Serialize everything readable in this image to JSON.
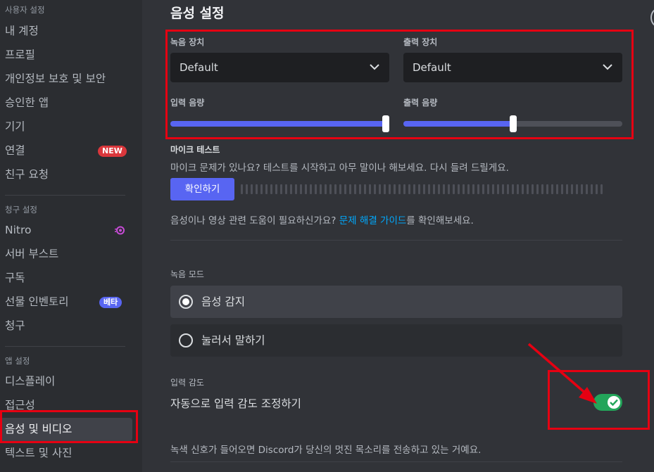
{
  "sidebar": {
    "sections": [
      {
        "header": "사용자 설정",
        "items": [
          {
            "label": "내 계정"
          },
          {
            "label": "프로필"
          },
          {
            "label": "개인정보 보호 및 보안"
          },
          {
            "label": "승인한 앱"
          },
          {
            "label": "기기"
          },
          {
            "label": "연결",
            "badge": "NEW"
          },
          {
            "label": "친구 요청"
          }
        ]
      },
      {
        "header": "청구 설정",
        "items": [
          {
            "label": "Nitro"
          },
          {
            "label": "서버 부스트"
          },
          {
            "label": "구독"
          },
          {
            "label": "선물 인벤토리",
            "badge": "베타"
          },
          {
            "label": "청구"
          }
        ]
      },
      {
        "header": "앱 설정",
        "items": [
          {
            "label": "디스플레이"
          },
          {
            "label": "접근성"
          },
          {
            "label": "음성 및 비디오",
            "active": true
          },
          {
            "label": "텍스트 및 사진"
          }
        ]
      }
    ]
  },
  "main": {
    "title": "음성 설정",
    "input_device": {
      "label": "녹음 장치",
      "value": "Default"
    },
    "output_device": {
      "label": "출력 장치",
      "value": "Default"
    },
    "input_volume": {
      "label": "입력 음량",
      "level": 1.0
    },
    "output_volume": {
      "label": "출력 음량",
      "level": 0.5
    },
    "mic_test": {
      "label": "마이크 테스트",
      "description": "마이크 문제가 있나요? 테스트를 시작하고 아무 말이나 해보세요. 다시 들려 드릴게요.",
      "button": "확인하기"
    },
    "help": {
      "prefix": "음성이나 영상 관련 도움이 필요하신가요? ",
      "link": "문제 해결 가이드",
      "suffix": "를 확인해보세요."
    },
    "input_mode": {
      "label": "녹음 모드",
      "options": [
        {
          "label": "음성 감지",
          "selected": true
        },
        {
          "label": "눌러서 말하기",
          "selected": false
        }
      ]
    },
    "sensitivity": {
      "label": "입력 감도",
      "auto_label": "자동으로 입력 감도 조정하기",
      "auto_enabled": true,
      "note": "녹색 신호가 들어오면 Discord가 당신의 멋진 목소리를 전송하고 있는 거예요."
    }
  },
  "colors": {
    "accent": "#5865f2",
    "toggle_on": "#23a55a",
    "badge_new": "#da373c",
    "annotation": "#e60012",
    "link": "#00a8fc"
  }
}
